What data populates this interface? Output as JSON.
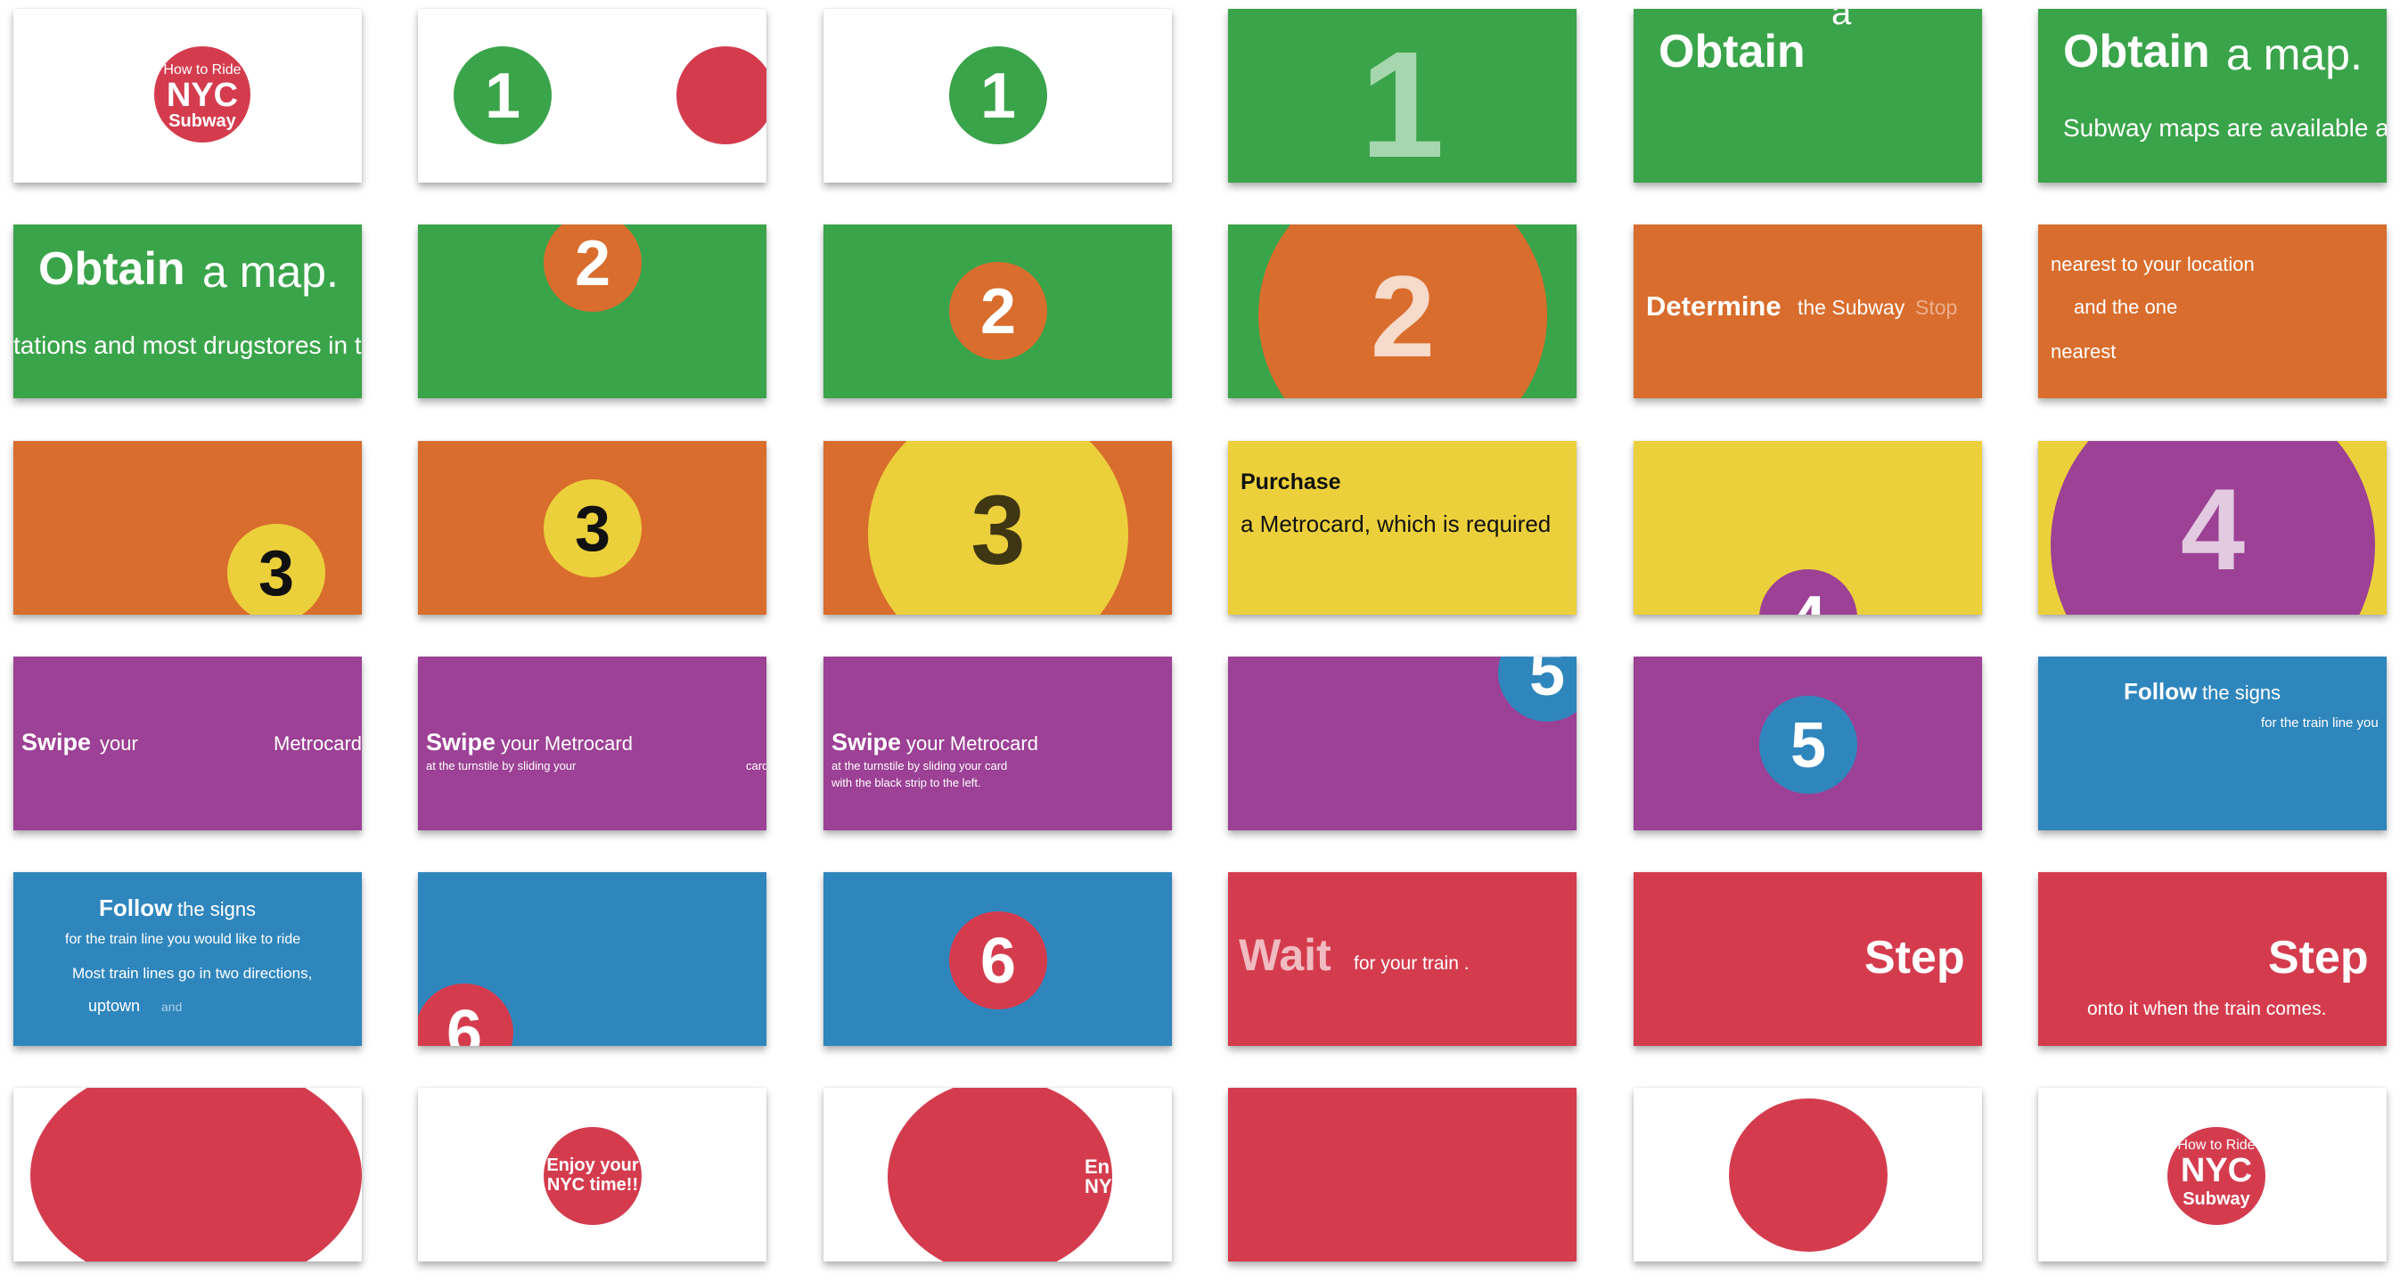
{
  "colors": {
    "white": "#ffffff",
    "green": "#3aa44a",
    "orange": "#d96d2d",
    "yellow": "#ecd03b",
    "purple": "#9c4195",
    "blue": "#2f86bd",
    "red": "#d43c4e"
  },
  "slides": [
    {
      "bg": "white",
      "items": [
        {
          "kind": "circle",
          "name": "title-circle",
          "color": "red"
        },
        {
          "kind": "text",
          "name": "how-to-ride-text",
          "text": "How to Ride"
        },
        {
          "kind": "text",
          "name": "nyc-text",
          "text": "NYC"
        },
        {
          "kind": "text",
          "name": "subway-text",
          "text": "Subway"
        }
      ]
    },
    {
      "bg": "white",
      "items": [
        {
          "kind": "circle",
          "name": "step-circle",
          "color": "green",
          "label": "1"
        },
        {
          "kind": "circle",
          "name": "entering-circle",
          "color": "red"
        }
      ]
    },
    {
      "bg": "white",
      "items": [
        {
          "kind": "circle",
          "name": "step-circle",
          "color": "green",
          "label": "1"
        }
      ]
    },
    {
      "bg": "green",
      "items": [
        {
          "kind": "text",
          "name": "step-number",
          "text": "1"
        }
      ]
    },
    {
      "bg": "green",
      "items": [
        {
          "kind": "text",
          "name": "heading-bold",
          "text": "Obtain"
        },
        {
          "kind": "text",
          "name": "heading-word",
          "text": "a"
        }
      ]
    },
    {
      "bg": "green",
      "items": [
        {
          "kind": "text",
          "name": "heading-bold",
          "text": "Obtain"
        },
        {
          "kind": "text",
          "name": "heading-rest",
          "text": "a map."
        },
        {
          "kind": "text",
          "name": "body-text",
          "text": "Subway maps are available at"
        }
      ]
    },
    {
      "bg": "green",
      "items": [
        {
          "kind": "text",
          "name": "heading-bold",
          "text": "Obtain"
        },
        {
          "kind": "text",
          "name": "heading-rest",
          "text": "a map."
        },
        {
          "kind": "text",
          "name": "body-text",
          "text": "tations and most drugstores in t"
        }
      ]
    },
    {
      "bg": "green",
      "items": [
        {
          "kind": "circle",
          "name": "step-circle",
          "color": "orange",
          "label": "2"
        }
      ]
    },
    {
      "bg": "green",
      "items": [
        {
          "kind": "circle",
          "name": "step-circle",
          "color": "orange",
          "label": "2"
        }
      ]
    },
    {
      "bg": "green",
      "items": [
        {
          "kind": "circle",
          "name": "step-circle",
          "color": "orange",
          "label": "2"
        }
      ]
    },
    {
      "bg": "orange",
      "items": [
        {
          "kind": "text",
          "name": "heading-bold",
          "text": "Determine"
        },
        {
          "kind": "text",
          "name": "heading-rest",
          "text": "the Subway"
        },
        {
          "kind": "text",
          "name": "heading-faded",
          "text": "Stop"
        }
      ]
    },
    {
      "bg": "orange",
      "items": [
        {
          "kind": "text",
          "name": "line-1",
          "text": "nearest  to your  location"
        },
        {
          "kind": "text",
          "name": "line-2",
          "text": "and  the  one"
        },
        {
          "kind": "text",
          "name": "line-3",
          "text": "nearest"
        }
      ]
    },
    {
      "bg": "orange",
      "items": [
        {
          "kind": "circle",
          "name": "step-circle",
          "color": "yellow",
          "label": "3"
        }
      ]
    },
    {
      "bg": "orange",
      "items": [
        {
          "kind": "circle",
          "name": "step-circle",
          "color": "yellow",
          "label": "3"
        }
      ]
    },
    {
      "bg": "orange",
      "items": [
        {
          "kind": "circle",
          "name": "step-circle",
          "color": "yellow",
          "label": "3"
        }
      ]
    },
    {
      "bg": "yellow",
      "items": [
        {
          "kind": "text",
          "name": "heading-bold",
          "text": "Purchase"
        },
        {
          "kind": "text",
          "name": "body-text",
          "text": "a  Metrocard, which is required"
        }
      ]
    },
    {
      "bg": "yellow",
      "items": [
        {
          "kind": "circle",
          "name": "step-circle",
          "color": "purple",
          "label": "4"
        }
      ]
    },
    {
      "bg": "yellow",
      "items": [
        {
          "kind": "circle",
          "name": "step-circle",
          "color": "purple",
          "label": "4"
        }
      ]
    },
    {
      "bg": "purple",
      "items": [
        {
          "kind": "text",
          "name": "heading-bold",
          "text": "Swipe"
        },
        {
          "kind": "text",
          "name": "heading-rest",
          "text": "your"
        },
        {
          "kind": "text",
          "name": "heading-word",
          "text": "Metrocard"
        }
      ]
    },
    {
      "bg": "purple",
      "items": [
        {
          "kind": "text",
          "name": "heading-bold",
          "text": "Swipe"
        },
        {
          "kind": "text",
          "name": "heading-rest",
          "text": "your  Metrocard"
        },
        {
          "kind": "text",
          "name": "body-text",
          "text": "at the turnstile by sliding your"
        },
        {
          "kind": "text",
          "name": "body-word",
          "text": "card"
        }
      ]
    },
    {
      "bg": "purple",
      "items": [
        {
          "kind": "text",
          "name": "heading-bold",
          "text": "Swipe"
        },
        {
          "kind": "text",
          "name": "heading-rest",
          "text": "your  Metrocard"
        },
        {
          "kind": "text",
          "name": "body-text",
          "text": "at the turnstile by sliding your card"
        },
        {
          "kind": "text",
          "name": "body-text-2",
          "text": "with  the  black strip to the left."
        }
      ]
    },
    {
      "bg": "purple",
      "items": [
        {
          "kind": "circle",
          "name": "step-circle",
          "color": "blue",
          "label": "5"
        }
      ]
    },
    {
      "bg": "purple",
      "items": [
        {
          "kind": "circle",
          "name": "step-circle",
          "color": "blue",
          "label": "5"
        }
      ]
    },
    {
      "bg": "blue",
      "items": [
        {
          "kind": "text",
          "name": "heading-bold",
          "text": "Follow"
        },
        {
          "kind": "text",
          "name": "heading-rest",
          "text": "the signs"
        },
        {
          "kind": "text",
          "name": "body-text",
          "text": "for the train line you"
        }
      ]
    },
    {
      "bg": "blue",
      "items": [
        {
          "kind": "text",
          "name": "heading-bold",
          "text": "Follow"
        },
        {
          "kind": "text",
          "name": "heading-rest",
          "text": "the signs"
        },
        {
          "kind": "text",
          "name": "body-text",
          "text": "for the train line you would like to ride"
        },
        {
          "kind": "text",
          "name": "body-text-2",
          "text": "Most train lines go in two directions,"
        },
        {
          "kind": "text",
          "name": "body-word",
          "text": "uptown"
        },
        {
          "kind": "text",
          "name": "body-faded",
          "text": "and"
        }
      ]
    },
    {
      "bg": "blue",
      "items": [
        {
          "kind": "circle",
          "name": "step-circle",
          "color": "red",
          "label": "6"
        }
      ]
    },
    {
      "bg": "blue",
      "items": [
        {
          "kind": "circle",
          "name": "step-circle",
          "color": "red",
          "label": "6"
        }
      ]
    },
    {
      "bg": "red",
      "items": [
        {
          "kind": "text",
          "name": "heading-faded",
          "text": "Wait"
        },
        {
          "kind": "text",
          "name": "heading-rest",
          "text": "for your train ."
        }
      ]
    },
    {
      "bg": "red",
      "items": [
        {
          "kind": "text",
          "name": "heading-bold",
          "text": "Step"
        }
      ]
    },
    {
      "bg": "red",
      "items": [
        {
          "kind": "text",
          "name": "heading-bold",
          "text": "Step"
        },
        {
          "kind": "text",
          "name": "body-text",
          "text": "onto it when the train comes."
        }
      ]
    },
    {
      "bg": "white",
      "items": [
        {
          "kind": "circle",
          "name": "closing-circle",
          "color": "red"
        }
      ]
    },
    {
      "bg": "white",
      "items": [
        {
          "kind": "circle",
          "name": "closing-circle",
          "color": "red"
        },
        {
          "kind": "text",
          "name": "enjoy-line-1",
          "text": "Enjoy your"
        },
        {
          "kind": "text",
          "name": "enjoy-line-2",
          "text": "NYC time!!"
        }
      ]
    },
    {
      "bg": "white",
      "items": [
        {
          "kind": "circle",
          "name": "closing-circle",
          "color": "red"
        },
        {
          "kind": "text",
          "name": "enjoy-line-1",
          "text": "En"
        },
        {
          "kind": "text",
          "name": "enjoy-line-2",
          "text": "NY"
        }
      ]
    },
    {
      "bg": "red",
      "items": []
    },
    {
      "bg": "white",
      "items": [
        {
          "kind": "circle",
          "name": "closing-circle",
          "color": "red"
        }
      ]
    },
    {
      "bg": "white",
      "items": [
        {
          "kind": "circle",
          "name": "title-circle",
          "color": "red"
        },
        {
          "kind": "text",
          "name": "how-to-ride-text",
          "text": "How to Ride"
        },
        {
          "kind": "text",
          "name": "nyc-text",
          "text": "NYC"
        },
        {
          "kind": "text",
          "name": "subway-text",
          "text": "Subway"
        }
      ]
    }
  ]
}
